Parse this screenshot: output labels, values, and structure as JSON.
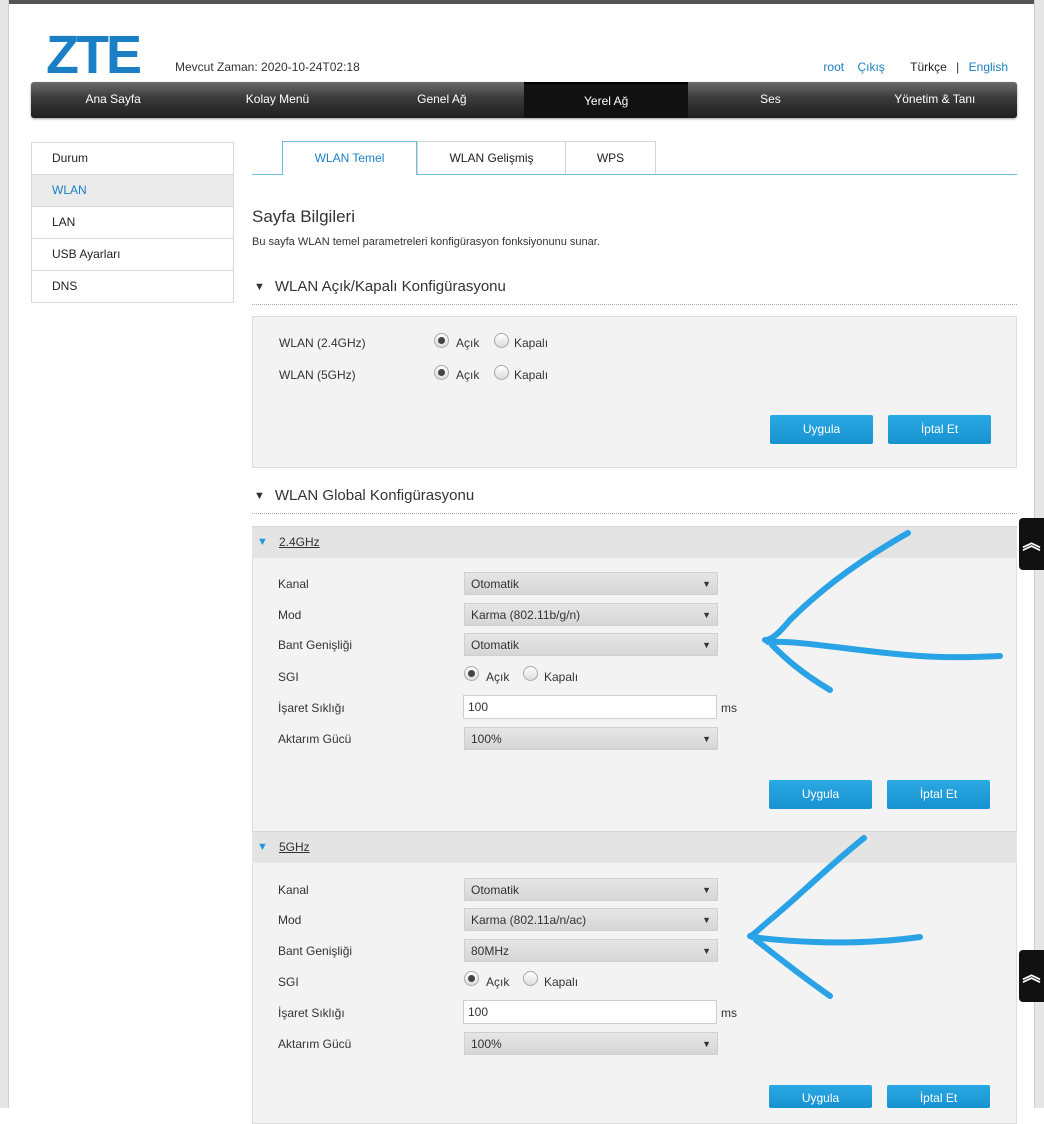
{
  "header": {
    "logo": "ZTE",
    "current_time": "Mevcut Zaman: 2020-10-24T02:18",
    "user": "root",
    "logout": "Çıkış",
    "lang_tr": "Türkçe",
    "lang_sep": "|",
    "lang_en": "English"
  },
  "nav": [
    "Ana Sayfa",
    "Kolay Menü",
    "Genel Ağ",
    "Yerel Ağ",
    "Ses",
    "Yönetim & Tanı"
  ],
  "sidebar": [
    "Durum",
    "WLAN",
    "LAN",
    "USB Ayarları",
    "DNS"
  ],
  "tabs": [
    "WLAN Temel",
    "WLAN Gelişmiş",
    "WPS"
  ],
  "page": {
    "title": "Sayfa Bilgileri",
    "description": "Bu sayfa WLAN temel parametreleri konfigürasyon fonksiyonunu sunar."
  },
  "onoff_section": {
    "title": "WLAN Açık/Kapalı Konfigürasyonu",
    "rows": [
      {
        "label": "WLAN (2.4GHz)",
        "on": "Açık",
        "off": "Kapalı"
      },
      {
        "label": "WLAN (5GHz)",
        "on": "Açık",
        "off": "Kapalı"
      }
    ],
    "apply": "Uygula",
    "cancel": "İptal Et"
  },
  "global_section": {
    "title": "WLAN Global Konfigürasyonu",
    "band24": {
      "header": "2.4GHz",
      "channel_label": "Kanal",
      "channel": "Otomatik",
      "mode_label": "Mod",
      "mode": "Karma (802.11b/g/n)",
      "bandwidth_label": "Bant Genişliği",
      "bandwidth": "Otomatik",
      "sgi_label": "SGI",
      "sgi_on": "Açık",
      "sgi_off": "Kapalı",
      "beacon_label": "İşaret Sıklığı",
      "beacon": "100",
      "beacon_unit": "ms",
      "power_label": "Aktarım Gücü",
      "power": "100%",
      "apply": "Uygula",
      "cancel": "İptal Et"
    },
    "band5": {
      "header": "5GHz",
      "channel_label": "Kanal",
      "channel": "Otomatik",
      "mode_label": "Mod",
      "mode": "Karma (802.11a/n/ac)",
      "bandwidth_label": "Bant Genişliği",
      "bandwidth": "80MHz",
      "sgi_label": "SGI",
      "sgi_on": "Açık",
      "sgi_off": "Kapalı",
      "beacon_label": "İşaret Sıklığı",
      "beacon": "100",
      "beacon_unit": "ms",
      "power_label": "Aktarım Gücü",
      "power": "100%",
      "apply": "Uygula",
      "cancel": "İptal Et"
    }
  },
  "annotation_color": "#2aa3e6"
}
